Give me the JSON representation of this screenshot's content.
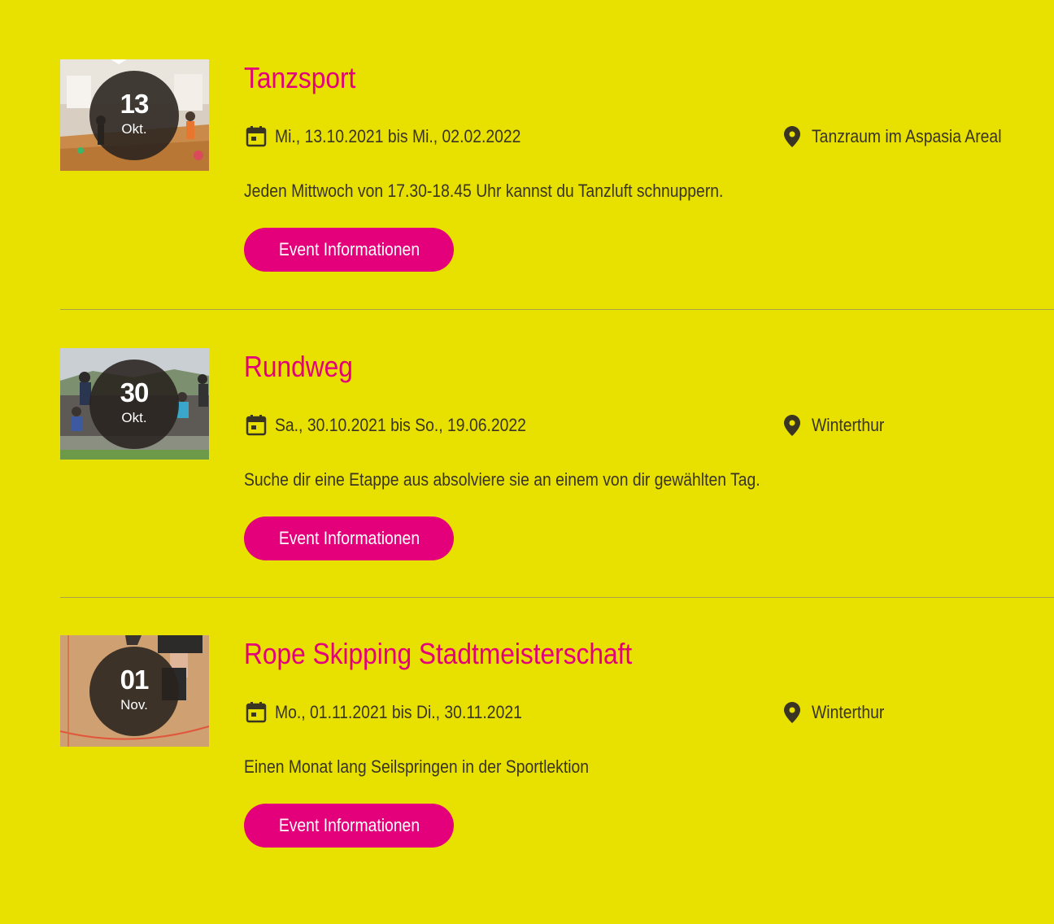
{
  "events": [
    {
      "day": "13",
      "month": "Okt.",
      "title": "Tanzsport",
      "date_range": "Mi., 13.10.2021 bis Mi., 02.02.2022",
      "location": "Tanzraum im Aspasia Areal",
      "description": "Jeden Mittwoch von 17.30-18.45 Uhr kannst du Tanzluft schnuppern.",
      "button_label": "Event Informationen"
    },
    {
      "day": "30",
      "month": "Okt.",
      "title": "Rundweg",
      "date_range": "Sa., 30.10.2021 bis So., 19.06.2022",
      "location": "Winterthur",
      "description": "Suche dir eine Etappe aus absolviere sie an einem von dir gewählten Tag.",
      "button_label": "Event Informationen"
    },
    {
      "day": "01",
      "month": "Nov.",
      "title": "Rope Skipping Stadtmeisterschaft",
      "date_range": "Mo., 01.11.2021 bis Di., 30.11.2021",
      "location": "Winterthur",
      "description": "Einen Monat lang Seilspringen in der Sportlektion",
      "button_label": "Event Informationen"
    }
  ],
  "icons": {
    "date": "calendar-icon",
    "location": "map-pin-icon"
  },
  "colors": {
    "background": "#e8e100",
    "accent": "#e4007a",
    "text": "#3a3422"
  }
}
